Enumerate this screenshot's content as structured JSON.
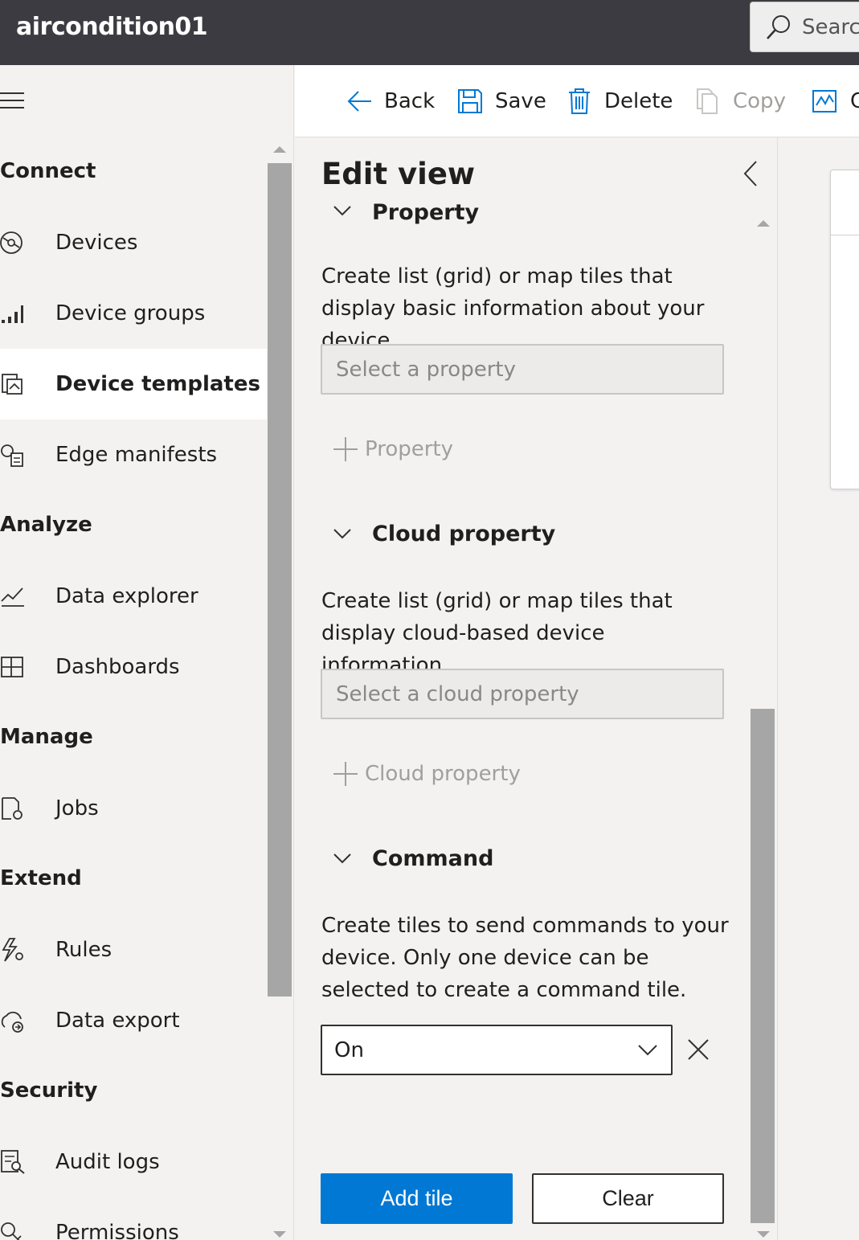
{
  "app": {
    "title": "aircondition01"
  },
  "search": {
    "placeholder": "Search"
  },
  "sidebar": {
    "sections": [
      {
        "label": "Connect"
      },
      {
        "label": "Analyze"
      },
      {
        "label": "Manage"
      },
      {
        "label": "Extend"
      },
      {
        "label": "Security"
      }
    ],
    "items": [
      {
        "label": "Devices",
        "icon": "devices-icon"
      },
      {
        "label": "Device groups",
        "icon": "device-groups-icon"
      },
      {
        "label": "Device templates",
        "icon": "device-templates-icon",
        "active": true
      },
      {
        "label": "Edge manifests",
        "icon": "edge-manifests-icon"
      },
      {
        "label": "Data explorer",
        "icon": "data-explorer-icon"
      },
      {
        "label": "Dashboards",
        "icon": "dashboards-icon"
      },
      {
        "label": "Jobs",
        "icon": "jobs-icon"
      },
      {
        "label": "Rules",
        "icon": "rules-icon"
      },
      {
        "label": "Data export",
        "icon": "data-export-icon"
      },
      {
        "label": "Audit logs",
        "icon": "audit-logs-icon"
      },
      {
        "label": "Permissions",
        "icon": "permissions-icon"
      }
    ]
  },
  "toolbar": {
    "back": "Back",
    "save": "Save",
    "delete": "Delete",
    "copy": "Copy",
    "configure": "C"
  },
  "panel": {
    "title": "Edit view",
    "property": {
      "heading": "Property",
      "description": "Create list (grid) or map tiles that display basic information about your device.",
      "select_placeholder": "Select a property",
      "add_label": "Property"
    },
    "cloud_property": {
      "heading": "Cloud property",
      "description": "Create list (grid) or map tiles that display cloud-based device information.",
      "select_placeholder": "Select a cloud property",
      "add_label": "Cloud property"
    },
    "command": {
      "heading": "Command",
      "description": "Create tiles to send commands to your device. Only one device can be selected to create a command tile.",
      "selected_value": "On"
    },
    "add_tile": "Add tile",
    "clear": "Clear"
  },
  "colors": {
    "header_bg": "#3c3b41",
    "accent": "#0078d4",
    "panel_bg": "#f3f2f1"
  }
}
